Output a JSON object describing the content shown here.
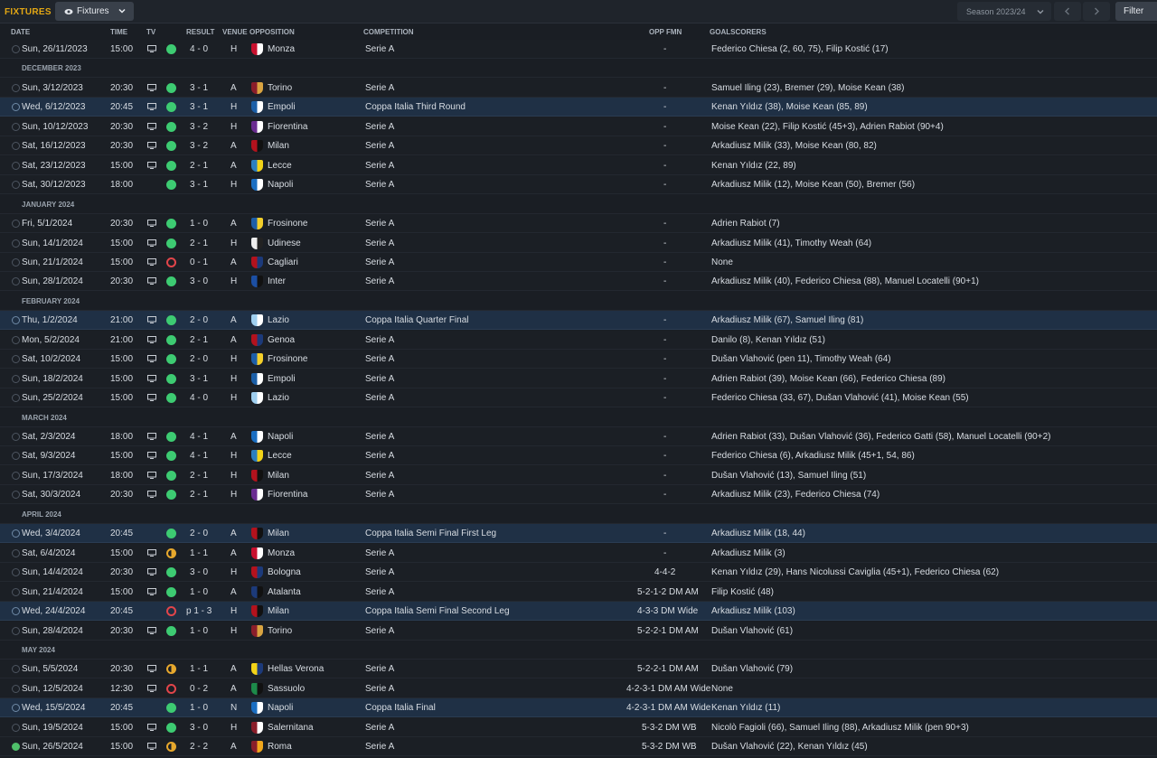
{
  "topbar": {
    "title": "FIXTURES",
    "view_dropdown": "Fixtures",
    "season": "Season 2023/24",
    "filter_label": "Filter"
  },
  "columns": {
    "date": "DATE",
    "time": "TIME",
    "tv": "TV",
    "result": "RESULT",
    "venue": "VENUE",
    "opposition": "OPPOSITION",
    "competition": "COMPETITION",
    "opp_fmn": "OPP FMN",
    "goalscorers": "GOALSCORERS"
  },
  "colors": {
    "accent": "#e3a714",
    "win": "#3dcb72",
    "loss": "#e2454a",
    "draw": "#e7a82d",
    "cup_row": "#1f3045"
  },
  "rows": [
    {
      "type": "fixture",
      "date": "Sun, 26/11/2023",
      "time": "15:00",
      "tv": true,
      "status": "win",
      "result": "4 - 0",
      "venue": "H",
      "opposition": "Monza",
      "crest": "#c8102e",
      "crest2": "#ffffff",
      "competition": "Serie A",
      "fmn": "-",
      "scorers": "Federico Chiesa (2, 60, 75), Filip Kostić (17)",
      "cup": false
    },
    {
      "type": "month",
      "label": "DECEMBER 2023"
    },
    {
      "type": "fixture",
      "date": "Sun, 3/12/2023",
      "time": "20:30",
      "tv": true,
      "status": "win",
      "result": "3 - 1",
      "venue": "A",
      "opposition": "Torino",
      "crest": "#8a1e2a",
      "crest2": "#d9a441",
      "competition": "Serie A",
      "fmn": "-",
      "scorers": "Samuel Iling (23), Bremer (29), Moise Kean (38)",
      "cup": false
    },
    {
      "type": "fixture",
      "date": "Wed, 6/12/2023",
      "time": "20:45",
      "tv": true,
      "status": "win",
      "result": "3 - 1",
      "venue": "H",
      "opposition": "Empoli",
      "crest": "#1b5fa8",
      "crest2": "#ffffff",
      "competition": "Coppa Italia Third Round",
      "fmn": "-",
      "scorers": "Kenan Yıldız (38), Moise Kean (85, 89)",
      "cup": true
    },
    {
      "type": "fixture",
      "date": "Sun, 10/12/2023",
      "time": "20:30",
      "tv": true,
      "status": "win",
      "result": "3 - 2",
      "venue": "H",
      "opposition": "Fiorentina",
      "crest": "#6a2c91",
      "crest2": "#ffffff",
      "competition": "Serie A",
      "fmn": "-",
      "scorers": "Moise Kean (22), Filip Kostić (45+3), Adrien Rabiot (90+4)",
      "cup": false
    },
    {
      "type": "fixture",
      "date": "Sat, 16/12/2023",
      "time": "20:30",
      "tv": true,
      "status": "win",
      "result": "3 - 2",
      "venue": "A",
      "opposition": "Milan",
      "crest": "#b3121d",
      "crest2": "#111111",
      "competition": "Serie A",
      "fmn": "-",
      "scorers": "Arkadiusz Milik (33), Moise Kean (80, 82)",
      "cup": false
    },
    {
      "type": "fixture",
      "date": "Sat, 23/12/2023",
      "time": "15:00",
      "tv": true,
      "status": "win",
      "result": "2 - 1",
      "venue": "A",
      "opposition": "Lecce",
      "crest": "#2a7fc0",
      "crest2": "#f2d318",
      "competition": "Serie A",
      "fmn": "-",
      "scorers": "Kenan Yıldız (22, 89)",
      "cup": false
    },
    {
      "type": "fixture",
      "date": "Sat, 30/12/2023",
      "time": "18:00",
      "tv": false,
      "status": "win",
      "result": "3 - 1",
      "venue": "H",
      "opposition": "Napoli",
      "crest": "#1a6ec2",
      "crest2": "#ffffff",
      "competition": "Serie A",
      "fmn": "-",
      "scorers": "Arkadiusz Milik (12), Moise Kean (50), Bremer (56)",
      "cup": false
    },
    {
      "type": "month",
      "label": "JANUARY 2024"
    },
    {
      "type": "fixture",
      "date": "Fri, 5/1/2024",
      "time": "20:30",
      "tv": true,
      "status": "win",
      "result": "1 - 0",
      "venue": "A",
      "opposition": "Frosinone",
      "crest": "#1d5ea8",
      "crest2": "#f4cf2a",
      "competition": "Serie A",
      "fmn": "-",
      "scorers": "Adrien Rabiot (7)",
      "cup": false
    },
    {
      "type": "fixture",
      "date": "Sun, 14/1/2024",
      "time": "15:00",
      "tv": true,
      "status": "win",
      "result": "2 - 1",
      "venue": "H",
      "opposition": "Udinese",
      "crest": "#eeeeee",
      "crest2": "#222222",
      "competition": "Serie A",
      "fmn": "-",
      "scorers": "Arkadiusz Milik (41), Timothy Weah (64)",
      "cup": false
    },
    {
      "type": "fixture",
      "date": "Sun, 21/1/2024",
      "time": "15:00",
      "tv": true,
      "status": "loss",
      "result": "0 - 1",
      "venue": "A",
      "opposition": "Cagliari",
      "crest": "#b3121d",
      "crest2": "#1c3a7a",
      "competition": "Serie A",
      "fmn": "-",
      "scorers": "None",
      "cup": false
    },
    {
      "type": "fixture",
      "date": "Sun, 28/1/2024",
      "time": "20:30",
      "tv": true,
      "status": "win",
      "result": "3 - 0",
      "venue": "H",
      "opposition": "Inter",
      "crest": "#1c4fa3",
      "crest2": "#111111",
      "competition": "Serie A",
      "fmn": "-",
      "scorers": "Arkadiusz Milik (40), Federico Chiesa (88), Manuel Locatelli (90+1)",
      "cup": false
    },
    {
      "type": "month",
      "label": "FEBRUARY 2024"
    },
    {
      "type": "fixture",
      "date": "Thu, 1/2/2024",
      "time": "21:00",
      "tv": true,
      "status": "win",
      "result": "2 - 0",
      "venue": "A",
      "opposition": "Lazio",
      "crest": "#9fcff0",
      "crest2": "#ffffff",
      "competition": "Coppa Italia Quarter Final",
      "fmn": "-",
      "scorers": "Arkadiusz Milik (67), Samuel Iling (81)",
      "cup": true
    },
    {
      "type": "fixture",
      "date": "Mon, 5/2/2024",
      "time": "21:00",
      "tv": true,
      "status": "win",
      "result": "2 - 1",
      "venue": "A",
      "opposition": "Genoa",
      "crest": "#b3121d",
      "crest2": "#1c3a7a",
      "competition": "Serie A",
      "fmn": "-",
      "scorers": "Danilo (8), Kenan Yıldız (51)",
      "cup": false
    },
    {
      "type": "fixture",
      "date": "Sat, 10/2/2024",
      "time": "15:00",
      "tv": true,
      "status": "win",
      "result": "2 - 0",
      "venue": "H",
      "opposition": "Frosinone",
      "crest": "#1d5ea8",
      "crest2": "#f4cf2a",
      "competition": "Serie A",
      "fmn": "-",
      "scorers": "Dušan Vlahović (pen 11), Timothy Weah (64)",
      "cup": false
    },
    {
      "type": "fixture",
      "date": "Sun, 18/2/2024",
      "time": "15:00",
      "tv": true,
      "status": "win",
      "result": "3 - 1",
      "venue": "H",
      "opposition": "Empoli",
      "crest": "#1b5fa8",
      "crest2": "#ffffff",
      "competition": "Serie A",
      "fmn": "-",
      "scorers": "Adrien Rabiot (39), Moise Kean (66), Federico Chiesa (89)",
      "cup": false
    },
    {
      "type": "fixture",
      "date": "Sun, 25/2/2024",
      "time": "15:00",
      "tv": true,
      "status": "win",
      "result": "4 - 0",
      "venue": "H",
      "opposition": "Lazio",
      "crest": "#9fcff0",
      "crest2": "#ffffff",
      "competition": "Serie A",
      "fmn": "-",
      "scorers": "Federico Chiesa (33, 67), Dušan Vlahović (41), Moise Kean (55)",
      "cup": false
    },
    {
      "type": "month",
      "label": "MARCH 2024"
    },
    {
      "type": "fixture",
      "date": "Sat, 2/3/2024",
      "time": "18:00",
      "tv": true,
      "status": "win",
      "result": "4 - 1",
      "venue": "A",
      "opposition": "Napoli",
      "crest": "#1a6ec2",
      "crest2": "#ffffff",
      "competition": "Serie A",
      "fmn": "-",
      "scorers": "Adrien Rabiot (33), Dušan Vlahović (36), Federico Gatti (58), Manuel Locatelli (90+2)",
      "cup": false
    },
    {
      "type": "fixture",
      "date": "Sat, 9/3/2024",
      "time": "15:00",
      "tv": true,
      "status": "win",
      "result": "4 - 1",
      "venue": "H",
      "opposition": "Lecce",
      "crest": "#2a7fc0",
      "crest2": "#f2d318",
      "competition": "Serie A",
      "fmn": "-",
      "scorers": "Federico Chiesa (6), Arkadiusz Milik (45+1, 54, 86)",
      "cup": false
    },
    {
      "type": "fixture",
      "date": "Sun, 17/3/2024",
      "time": "18:00",
      "tv": true,
      "status": "win",
      "result": "2 - 1",
      "venue": "H",
      "opposition": "Milan",
      "crest": "#b3121d",
      "crest2": "#111111",
      "competition": "Serie A",
      "fmn": "-",
      "scorers": "Dušan Vlahović (13), Samuel Iling (51)",
      "cup": false
    },
    {
      "type": "fixture",
      "date": "Sat, 30/3/2024",
      "time": "20:30",
      "tv": true,
      "status": "win",
      "result": "2 - 1",
      "venue": "H",
      "opposition": "Fiorentina",
      "crest": "#6a2c91",
      "crest2": "#ffffff",
      "competition": "Serie A",
      "fmn": "-",
      "scorers": "Arkadiusz Milik (23), Federico Chiesa (74)",
      "cup": false
    },
    {
      "type": "month",
      "label": "APRIL 2024"
    },
    {
      "type": "fixture",
      "date": "Wed, 3/4/2024",
      "time": "20:45",
      "tv": false,
      "status": "win",
      "result": "2 - 0",
      "venue": "A",
      "opposition": "Milan",
      "crest": "#b3121d",
      "crest2": "#111111",
      "competition": "Coppa Italia Semi Final First Leg",
      "fmn": "-",
      "scorers": "Arkadiusz Milik (18, 44)",
      "cup": true
    },
    {
      "type": "fixture",
      "date": "Sat, 6/4/2024",
      "time": "15:00",
      "tv": true,
      "status": "draw",
      "result": "1 - 1",
      "venue": "A",
      "opposition": "Monza",
      "crest": "#c8102e",
      "crest2": "#ffffff",
      "competition": "Serie A",
      "fmn": "-",
      "scorers": "Arkadiusz Milik (3)",
      "cup": false
    },
    {
      "type": "fixture",
      "date": "Sun, 14/4/2024",
      "time": "20:30",
      "tv": true,
      "status": "win",
      "result": "3 - 0",
      "venue": "H",
      "opposition": "Bologna",
      "crest": "#b3121d",
      "crest2": "#1c3a7a",
      "competition": "Serie A",
      "fmn": "4-4-2",
      "scorers": "Kenan Yıldız (29), Hans Nicolussi Caviglia (45+1), Federico Chiesa (62)",
      "cup": false
    },
    {
      "type": "fixture",
      "date": "Sun, 21/4/2024",
      "time": "15:00",
      "tv": true,
      "status": "win",
      "result": "1 - 0",
      "venue": "A",
      "opposition": "Atalanta",
      "crest": "#1c3a7a",
      "crest2": "#111111",
      "competition": "Serie A",
      "fmn": "5-2-1-2 DM AM",
      "scorers": "Filip Kostić (48)",
      "cup": false
    },
    {
      "type": "fixture",
      "date": "Wed, 24/4/2024",
      "time": "20:45",
      "tv": false,
      "status": "loss",
      "result": "p 1 - 3",
      "venue": "H",
      "opposition": "Milan",
      "crest": "#b3121d",
      "crest2": "#111111",
      "competition": "Coppa Italia Semi Final Second Leg",
      "fmn": "4-3-3 DM Wide",
      "scorers": "Arkadiusz Milik (103)",
      "cup": true
    },
    {
      "type": "fixture",
      "date": "Sun, 28/4/2024",
      "time": "20:30",
      "tv": true,
      "status": "win",
      "result": "1 - 0",
      "venue": "H",
      "opposition": "Torino",
      "crest": "#8a1e2a",
      "crest2": "#d9a441",
      "competition": "Serie A",
      "fmn": "5-2-2-1 DM AM",
      "scorers": "Dušan Vlahović (61)",
      "cup": false
    },
    {
      "type": "month",
      "label": "MAY 2024"
    },
    {
      "type": "fixture",
      "date": "Sun, 5/5/2024",
      "time": "20:30",
      "tv": true,
      "status": "draw",
      "result": "1 - 1",
      "venue": "A",
      "opposition": "Hellas Verona",
      "crest": "#f2d318",
      "crest2": "#1c3a7a",
      "competition": "Serie A",
      "fmn": "5-2-2-1 DM AM",
      "scorers": "Dušan Vlahović (79)",
      "cup": false
    },
    {
      "type": "fixture",
      "date": "Sun, 12/5/2024",
      "time": "12:30",
      "tv": true,
      "status": "loss",
      "result": "0 - 2",
      "venue": "A",
      "opposition": "Sassuolo",
      "crest": "#1d8a4a",
      "crest2": "#111111",
      "competition": "Serie A",
      "fmn": "4-2-3-1 DM AM Wide",
      "scorers": "None",
      "cup": false
    },
    {
      "type": "fixture",
      "date": "Wed, 15/5/2024",
      "time": "20:45",
      "tv": false,
      "status": "win",
      "result": "1 - 0",
      "venue": "N",
      "opposition": "Napoli",
      "crest": "#1a6ec2",
      "crest2": "#ffffff",
      "competition": "Coppa Italia Final",
      "fmn": "4-2-3-1 DM AM Wide",
      "scorers": "Kenan Yıldız (11)",
      "cup": true
    },
    {
      "type": "fixture",
      "date": "Sun, 19/5/2024",
      "time": "15:00",
      "tv": true,
      "status": "win",
      "result": "3 - 0",
      "venue": "H",
      "opposition": "Salernitana",
      "crest": "#8a1e2a",
      "crest2": "#ffffff",
      "competition": "Serie A",
      "fmn": "5-3-2 DM WB",
      "scorers": "Nicolò Fagioli (66), Samuel Iling (88), Arkadiusz Milik (pen 90+3)",
      "cup": false
    },
    {
      "type": "fixture",
      "date": "Sun, 26/5/2024",
      "time": "15:00",
      "tv": true,
      "status": "draw",
      "result": "2 - 2",
      "venue": "A",
      "opposition": "Roma",
      "crest": "#8a1e2a",
      "crest2": "#f2a81d",
      "competition": "Serie A",
      "fmn": "5-3-2 DM WB",
      "scorers": "Dušan Vlahović (22), Kenan Yıldız (45)",
      "cup": false,
      "last": true
    }
  ]
}
